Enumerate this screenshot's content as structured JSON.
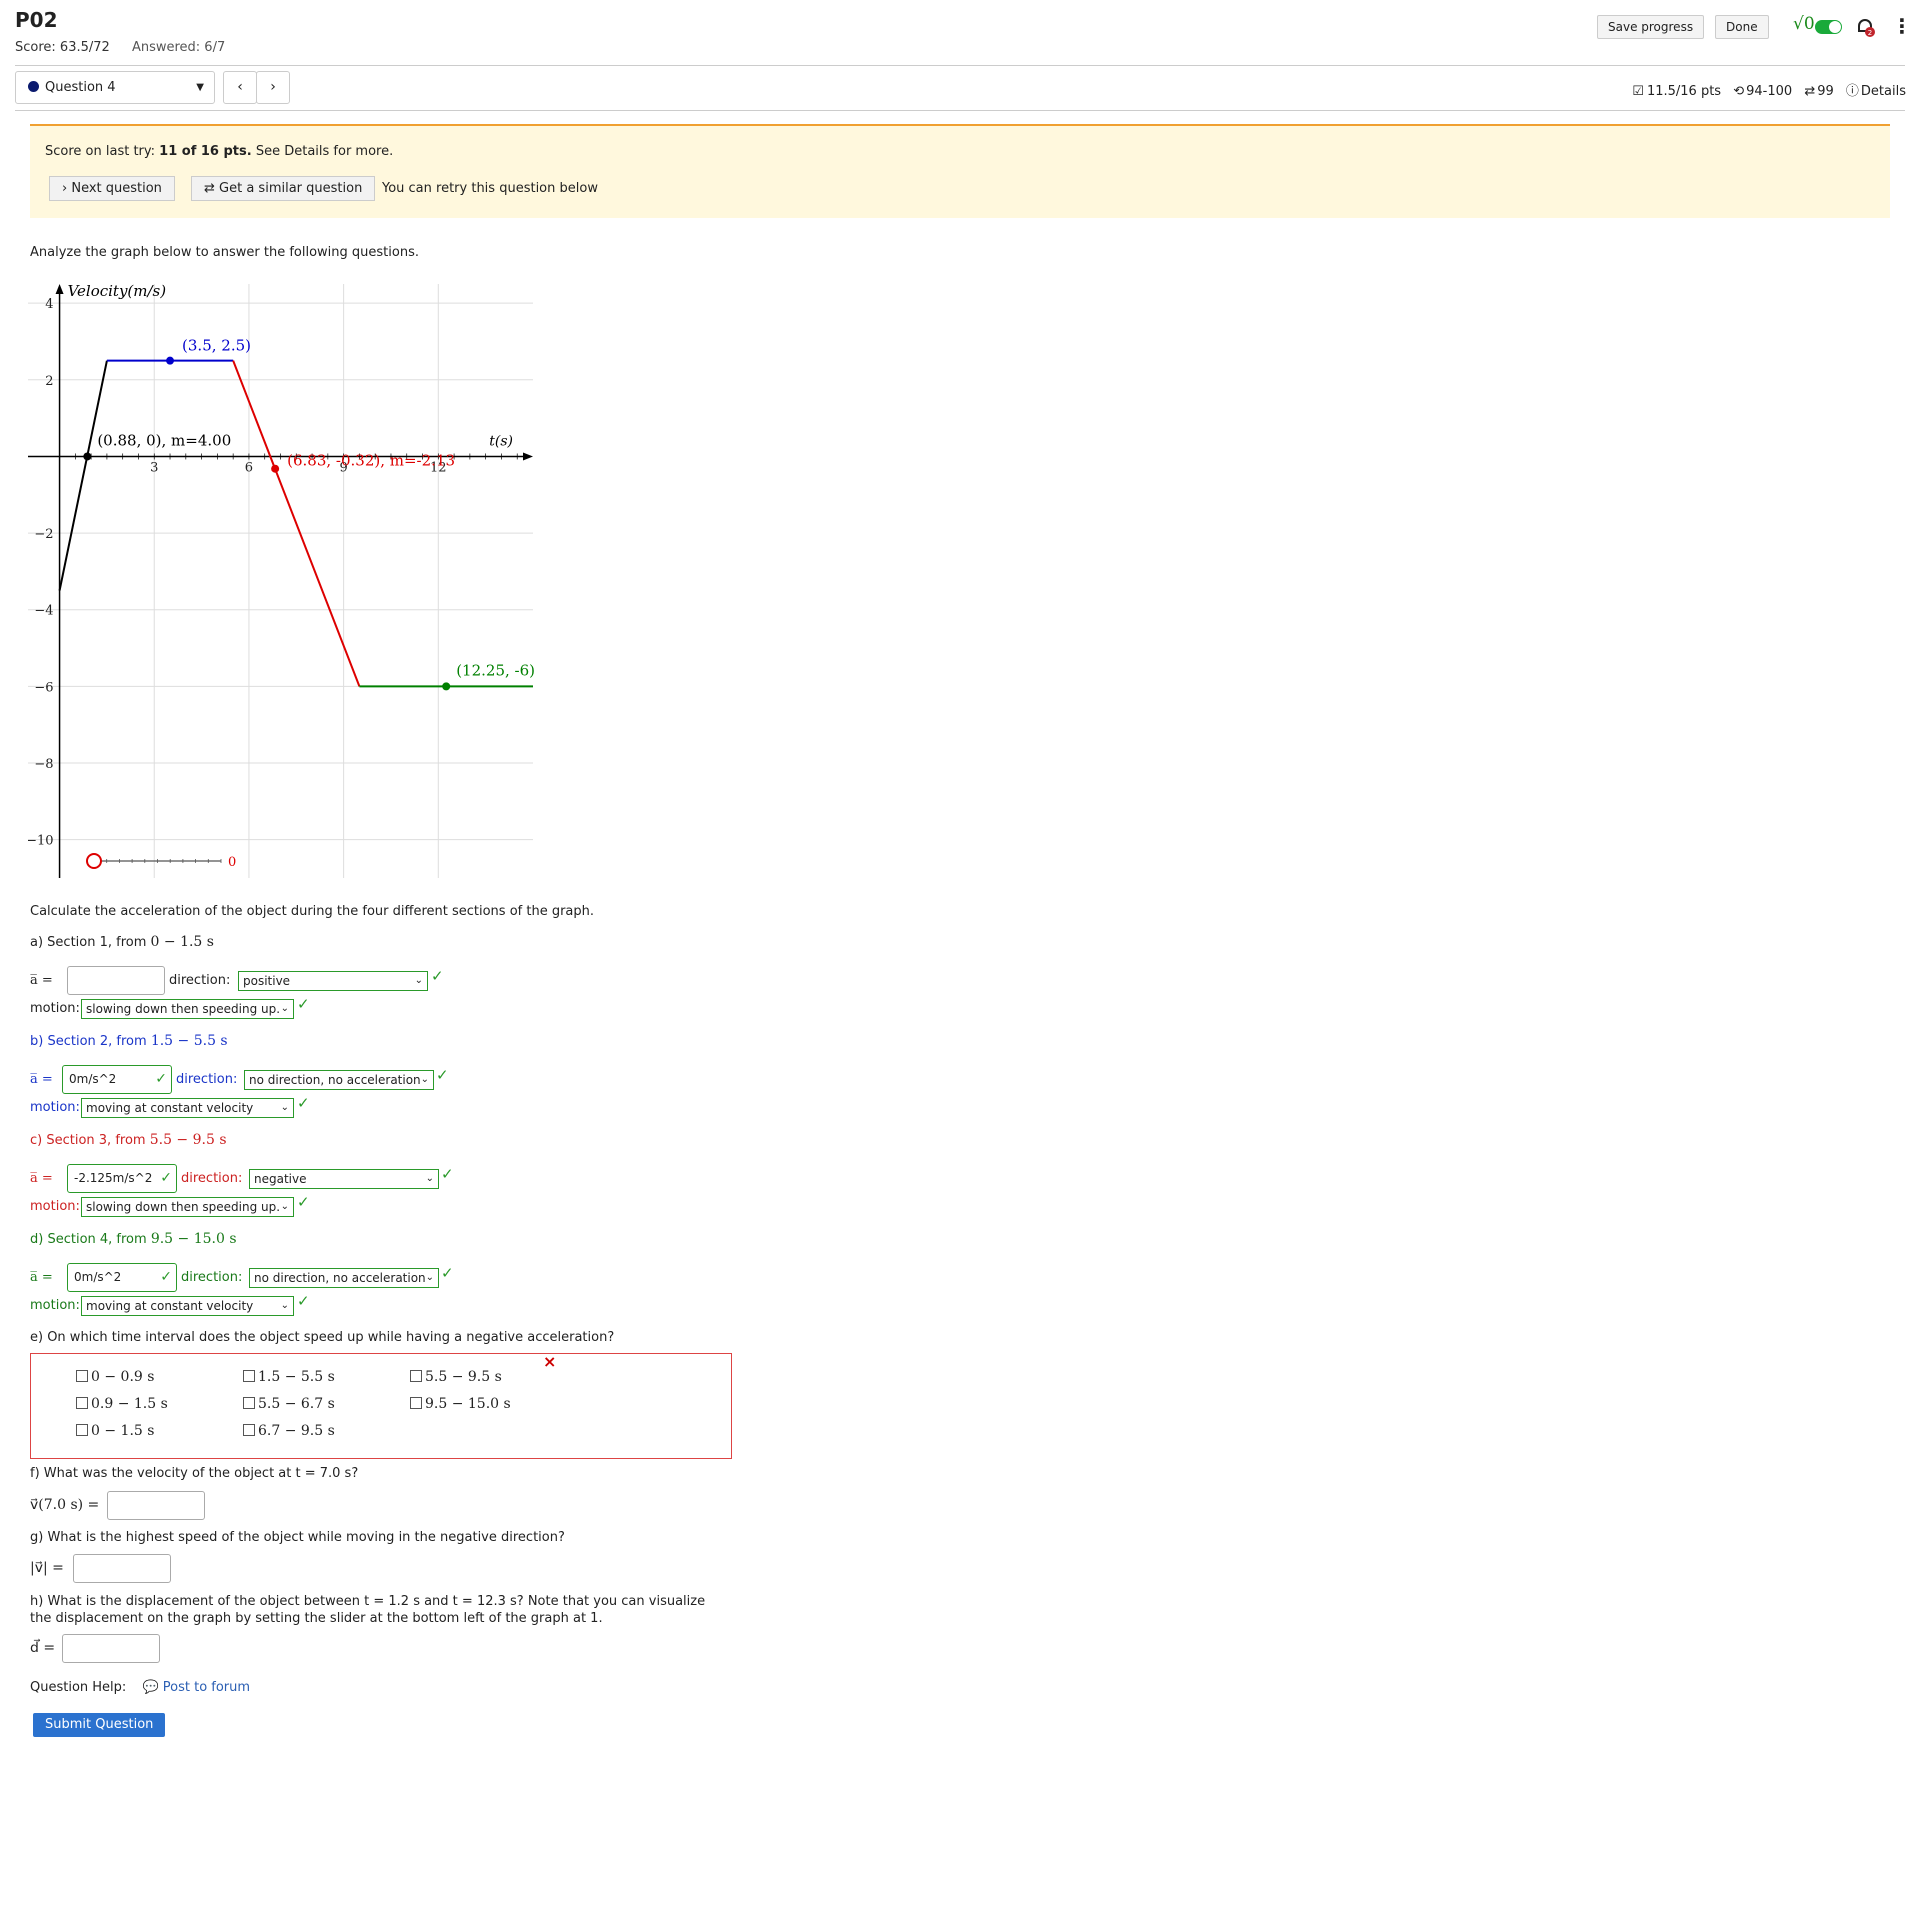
{
  "header": {
    "title": "P02",
    "score": "Score: 63.5/72",
    "answered": "Answered: 6/7",
    "save_progress": "Save progress",
    "done": "Done",
    "sqrt_label": "√0"
  },
  "nav": {
    "question_label": "Question 4",
    "prev": "‹",
    "next": "›"
  },
  "meta": {
    "points": "11.5/16 pts",
    "attempts": "94-100",
    "retries": "99",
    "details": "Details"
  },
  "notice": {
    "prefix": "Score on last try: ",
    "score_bold": "11 of 16 pts.",
    "suffix": " See Details for more.",
    "next_question": "Next question",
    "similar_question": "Get a similar question",
    "retry_text": "You can retry this question below"
  },
  "intro": "Analyze the graph below to answer the following questions.",
  "chart_data": {
    "type": "line",
    "ylabel": "Velocity(m/s)",
    "xlabel": "t(s)",
    "xlim": [
      -1,
      15
    ],
    "ylim": [
      -11,
      4.5
    ],
    "x_ticks": [
      3,
      6,
      9,
      12
    ],
    "y_ticks": [
      4,
      2,
      -2,
      -4,
      -6,
      -8,
      -10
    ],
    "series": [
      {
        "color": "#000000",
        "points": [
          [
            0,
            -3.5
          ],
          [
            1.5,
            2.5
          ]
        ]
      },
      {
        "color": "#0000cc",
        "points": [
          [
            1.5,
            2.5
          ],
          [
            5.5,
            2.5
          ]
        ]
      },
      {
        "color": "#dd0000",
        "points": [
          [
            5.5,
            2.5
          ],
          [
            9.5,
            -6
          ]
        ]
      },
      {
        "color": "#008000",
        "points": [
          [
            9.5,
            -6
          ],
          [
            15,
            -6
          ]
        ]
      }
    ],
    "annotations": [
      {
        "text": "(3.5, 2.5)",
        "x": 3.5,
        "y": 2.5,
        "color": "#0000cc"
      },
      {
        "text": "(0.88, 0), m=4.00",
        "x": 0.88,
        "y": 0,
        "color": "#000000"
      },
      {
        "text": "(6.83, -0.32), m=-2.13",
        "x": 6.83,
        "y": -0.32,
        "color": "#dd0000"
      },
      {
        "text": "(12.25, -6)",
        "x": 12.25,
        "y": -6,
        "color": "#008000"
      }
    ],
    "slider": {
      "value": "0"
    }
  },
  "questions": {
    "intro": "Calculate the acceleration of the object during the four different sections of the graph.",
    "a": {
      "title_prefix": "a) Section 1, from ",
      "range": "0 − 1.5 s",
      "abar": "a̅ =",
      "value": "",
      "direction_label": "direction:",
      "direction": "positive",
      "motion_label": "motion:",
      "motion": "slowing down then speeding up."
    },
    "b": {
      "title_prefix": "b) Section 2, from ",
      "range": "1.5 − 5.5 s",
      "abar": "a̅ =",
      "value": "0m/s^2",
      "direction_label": "direction:",
      "direction": "no direction, no acceleration",
      "motion_label": "motion:",
      "motion": "moving at constant velocity"
    },
    "c": {
      "title_prefix": "c) Section 3, from ",
      "range": "5.5 − 9.5 s",
      "abar": "a̅ =",
      "value": "-2.125m/s^2",
      "direction_label": "direction:",
      "direction": "negative",
      "motion_label": "motion:",
      "motion": "slowing down then speeding up."
    },
    "d": {
      "title_prefix": "d) Section 4, from ",
      "range": "9.5 − 15.0 s",
      "abar": "a̅ =",
      "value": "0m/s^2",
      "direction_label": "direction:",
      "direction": "no direction, no acceleration",
      "motion_label": "motion:",
      "motion": "moving at constant velocity"
    },
    "e": {
      "prompt": "e) On which time interval does the object speed up while having a negative acceleration?",
      "options": [
        "0 − 0.9 s",
        "0.9 − 1.5 s",
        "0 − 1.5 s",
        "1.5 − 5.5 s",
        "5.5 − 6.7 s",
        "6.7 − 9.5 s",
        "5.5 − 9.5 s",
        "9.5 − 15.0 s"
      ]
    },
    "f": {
      "prompt": "f) What was the velocity of the object at t = 7.0 s?",
      "label": "v⃗(7.0 s) =",
      "value": ""
    },
    "g": {
      "prompt": "g) What is the highest speed of the object while moving in the negative direction?",
      "label": "|v⃗| =",
      "value": ""
    },
    "h": {
      "prompt_line1": "h) What is the displacement of the object between t = 1.2 s and t = 12.3 s? Note that you can visualize",
      "prompt_line2": "the displacement on the graph by setting the slider at the bottom left of the graph at 1.",
      "label": "d⃗ =",
      "value": ""
    },
    "help_label": "Question Help:",
    "post_forum": "Post to forum",
    "submit": "Submit Question"
  }
}
